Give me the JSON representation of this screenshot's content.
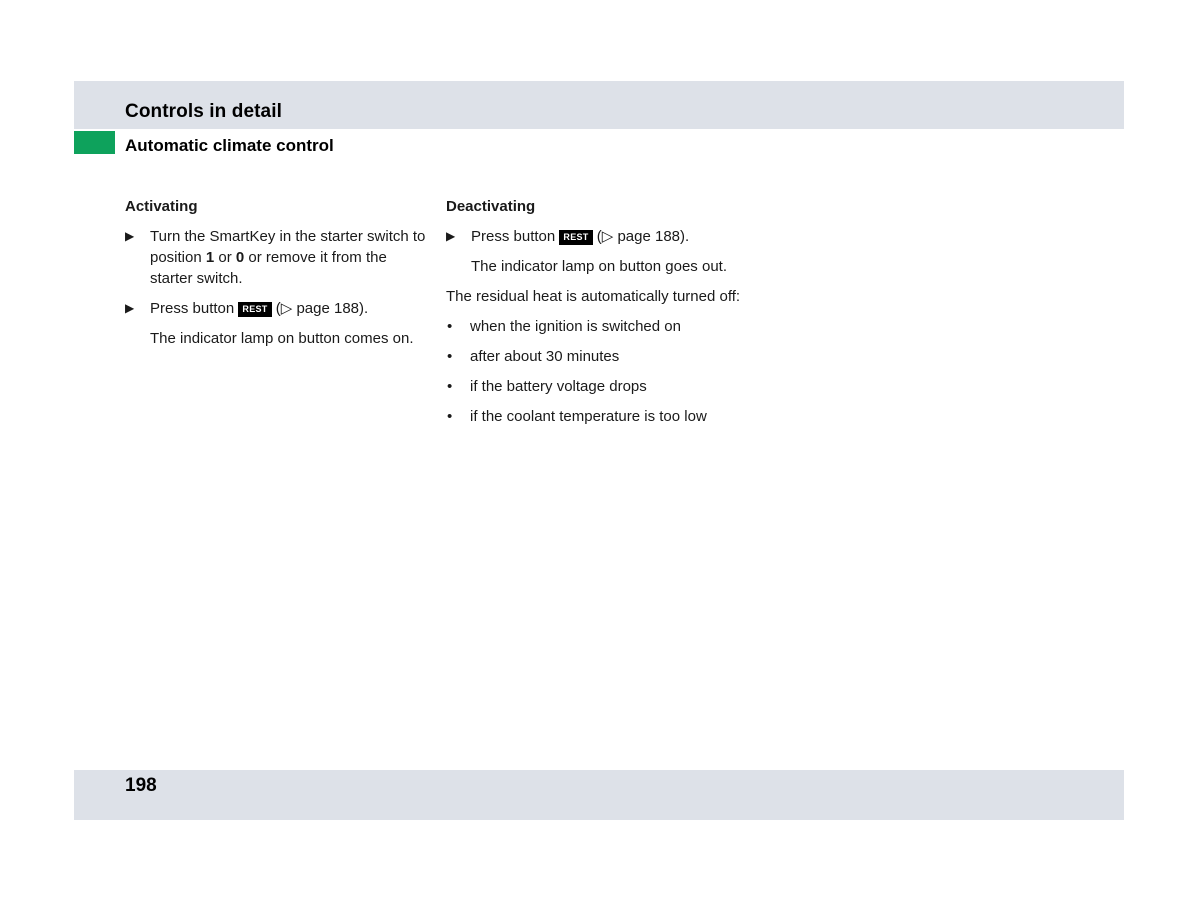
{
  "header": {
    "section_title": "Controls in detail",
    "subsection_title": "Automatic climate control",
    "accent_color": "#0ea25c",
    "band_color": "#dde1e8"
  },
  "activating": {
    "heading": "Activating",
    "step1": {
      "text_a": "Turn the SmartKey in the starter switch to position ",
      "pos1": "1",
      "text_b": " or ",
      "pos0": "0",
      "text_c": " or remove it from the starter switch."
    },
    "step2": {
      "text_a": "Press button ",
      "key_label": "REST",
      "text_b": " (▷ page 188)."
    },
    "result": "The indicator lamp on button comes on."
  },
  "deactivating": {
    "heading": "Deactivating",
    "step1": {
      "text_a": "Press button ",
      "key_label": "REST",
      "text_b": " (▷ page 188)."
    },
    "result": "The indicator lamp on button goes out.",
    "residual_intro": "The residual heat is automatically turned off:",
    "conditions": [
      "when the ignition is switched on",
      "after about 30 minutes",
      "if the battery voltage drops",
      "if the coolant temperature is too low"
    ]
  },
  "icons": {
    "step_arrow": "▶",
    "bullet": "•"
  },
  "footer": {
    "page_number": "198"
  }
}
